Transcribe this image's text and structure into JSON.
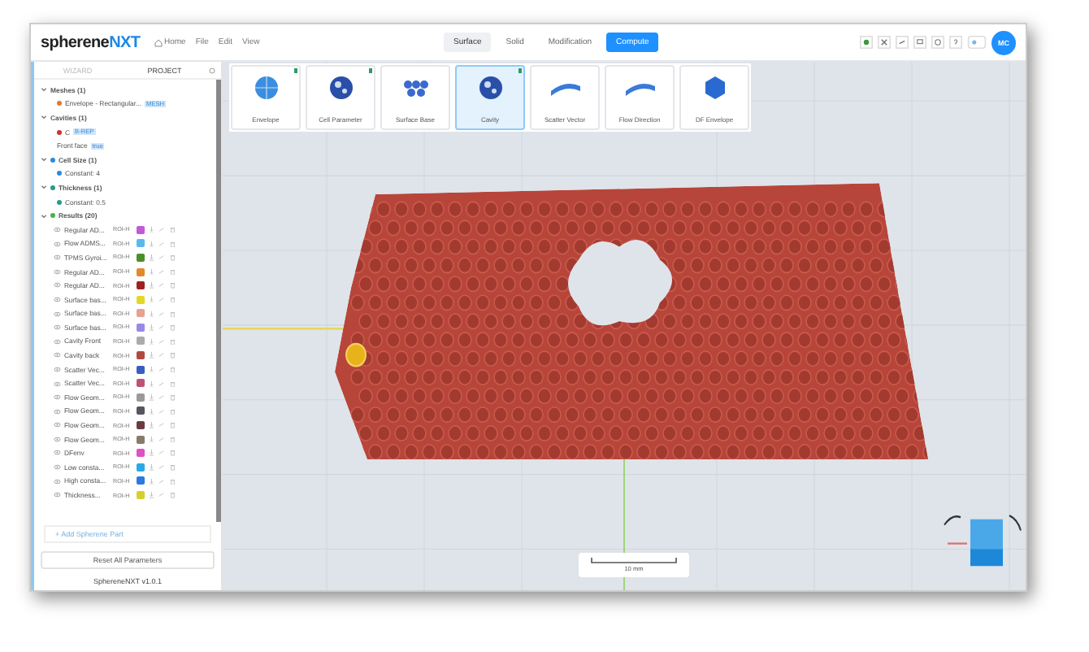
{
  "header": {
    "logo": {
      "main": "spherene",
      "accent": "NXT"
    },
    "menu": [
      {
        "label": "Home"
      },
      {
        "label": "File"
      },
      {
        "label": "Edit"
      },
      {
        "label": "View"
      }
    ],
    "tabs": [
      {
        "label": "Surface",
        "selected": true
      },
      {
        "label": "Solid",
        "selected": false
      },
      {
        "label": "Modification",
        "selected": false
      }
    ],
    "compute_button": "Compute",
    "avatar": "MC"
  },
  "sidebar": {
    "tabs": [
      {
        "label": "WIZARD",
        "selected": false
      },
      {
        "label": "PROJECT",
        "selected": true
      }
    ],
    "groups": [
      {
        "label": "Meshes (1)",
        "children": [
          {
            "label": "Envelope - Rectangular...",
            "badge": "MESH",
            "color": "#e07a2a"
          }
        ]
      },
      {
        "label": "Cavities (1)",
        "children": [
          {
            "label": "C",
            "badge": "B-REP",
            "color": "#d03030"
          },
          {
            "label": "Front face",
            "badge": "true"
          }
        ]
      },
      {
        "label": "Cell Size (1)",
        "color": "#2a8ae0",
        "children": [
          {
            "label": "Constant: 4",
            "color": "#2a8ae0"
          }
        ]
      },
      {
        "label": "Thickness (1)",
        "color": "#2a9a8a",
        "children": [
          {
            "label": "Constant: 0.5",
            "color": "#2a9a8a"
          }
        ]
      },
      {
        "label": "Results (20)",
        "color": "#4caf50"
      }
    ],
    "results": [
      {
        "name": "Regular AD...",
        "tag": "ROI-H",
        "color": "#c05ad6"
      },
      {
        "name": "Flow ADMS...",
        "tag": "ROI-H",
        "color": "#5bb8ee"
      },
      {
        "name": "TPMS Gyroi...",
        "tag": "ROI-H",
        "color": "#4c8f2a"
      },
      {
        "name": "Regular AD...",
        "tag": "ROI-H",
        "color": "#e08a2a"
      },
      {
        "name": "Regular AD...",
        "tag": "ROI-H",
        "color": "#a02020"
      },
      {
        "name": "Surface bas...",
        "tag": "ROI-H",
        "color": "#e6d62a"
      },
      {
        "name": "Surface bas...",
        "tag": "ROI-H",
        "color": "#e8a090"
      },
      {
        "name": "Surface bas...",
        "tag": "ROI-H",
        "color": "#9a8ae6"
      },
      {
        "name": "Cavity Front",
        "tag": "ROI-H",
        "color": "#aaaaaa"
      },
      {
        "name": "Cavity back",
        "tag": "ROI-H",
        "color": "#b04a40"
      },
      {
        "name": "Scatter Vec...",
        "tag": "ROI-H",
        "color": "#3a5ec0"
      },
      {
        "name": "Scatter Vec...",
        "tag": "ROI-H",
        "color": "#c0507a"
      },
      {
        "name": "Flow Geom...",
        "tag": "ROI-H",
        "color": "#9a9a9a"
      },
      {
        "name": "Flow Geom...",
        "tag": "ROI-H",
        "color": "#555560"
      },
      {
        "name": "Flow Geom...",
        "tag": "ROI-H",
        "color": "#6a3a40"
      },
      {
        "name": "Flow Geom...",
        "tag": "ROI-H",
        "color": "#8a7a6a"
      },
      {
        "name": "DFenv",
        "tag": "ROI-H",
        "color": "#e050c0"
      },
      {
        "name": "Low consta...",
        "tag": "ROI-H",
        "color": "#2aa8e8"
      },
      {
        "name": "High consta...",
        "tag": "ROI-H",
        "color": "#2a7ae0"
      },
      {
        "name": "Thickness...",
        "tag": "ROI-H",
        "color": "#d8d02a"
      }
    ],
    "add_part": "+ Add Spherene Part",
    "reset_button": "Reset All Parameters",
    "version": "SphereneNXT v1.0.1"
  },
  "toolbar": [
    {
      "label": "Envelope",
      "kind": "globe",
      "done": true,
      "selected": false
    },
    {
      "label": "Cell Parameter",
      "kind": "ball",
      "done": true,
      "selected": false
    },
    {
      "label": "Surface Base",
      "kind": "lattice",
      "done": false,
      "selected": false
    },
    {
      "label": "Cavity",
      "kind": "ball",
      "done": true,
      "selected": true
    },
    {
      "label": "Scatter Vector",
      "kind": "band",
      "done": false,
      "selected": false
    },
    {
      "label": "Flow Direction",
      "kind": "band",
      "done": false,
      "selected": false
    },
    {
      "label": "DF Envelope",
      "kind": "hex",
      "done": false,
      "selected": false
    }
  ],
  "viewport": {
    "scale": "10 mm"
  }
}
